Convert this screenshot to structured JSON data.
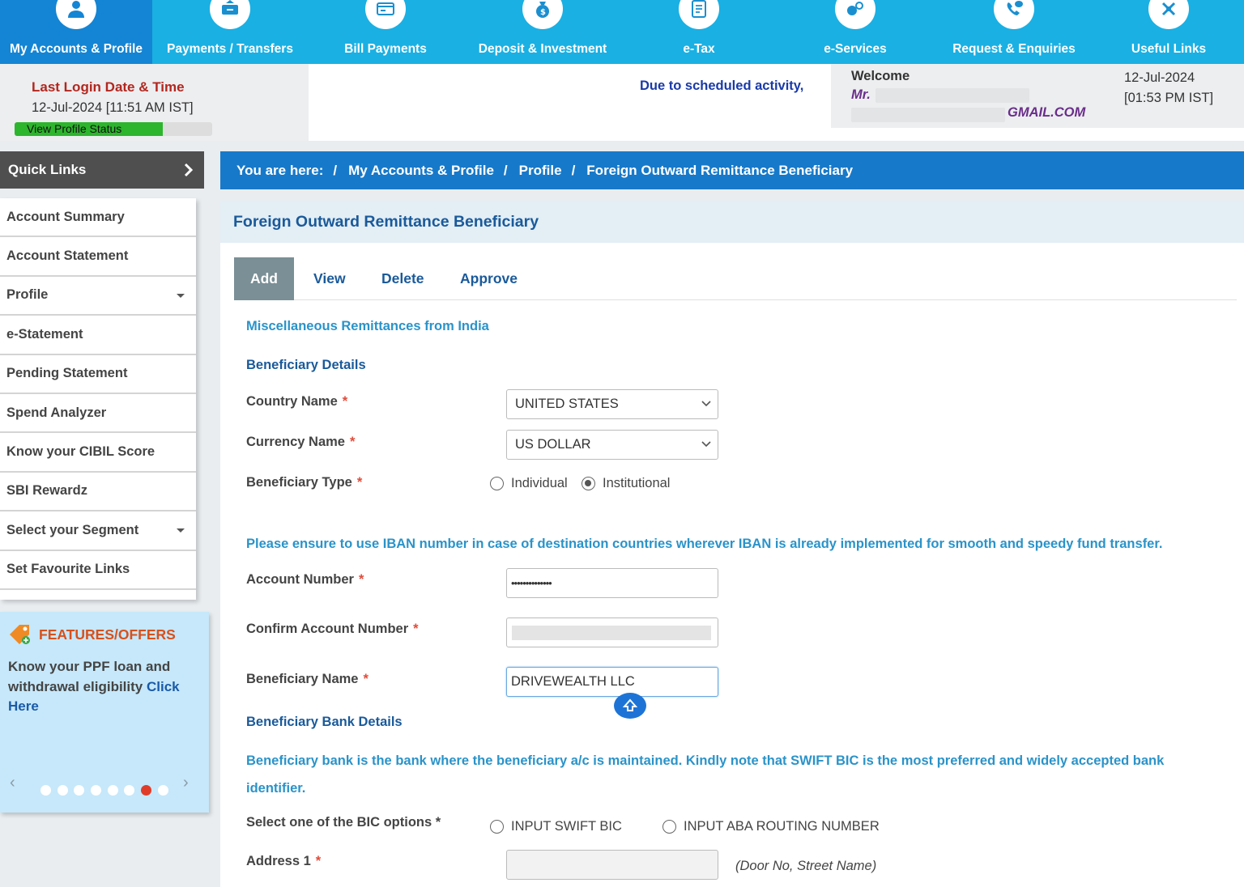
{
  "nav": [
    {
      "label": "My Accounts & Profile",
      "icon": "user-icon"
    },
    {
      "label": "Payments / Transfers",
      "icon": "transfer-icon"
    },
    {
      "label": "Bill Payments",
      "icon": "bill-icon"
    },
    {
      "label": "Deposit & Investment",
      "icon": "money-bag-icon"
    },
    {
      "label": "e-Tax",
      "icon": "tax-document-icon"
    },
    {
      "label": "e-Services",
      "icon": "services-icon"
    },
    {
      "label": "Request & Enquiries",
      "icon": "phone-chat-icon"
    },
    {
      "label": "Useful Links",
      "icon": "link-icon"
    }
  ],
  "header": {
    "last_login_title": "Last Login Date & Time",
    "last_login_value": "12-Jul-2024 [11:51 AM IST]",
    "profile_status_label": "View Profile Status",
    "profile_status_progress": 0.75,
    "marquee": "Due to scheduled activity,",
    "welcome_title": "Welcome",
    "welcome_name": "Mr.",
    "welcome_email": "GMAIL.COM",
    "date": "12-Jul-2024",
    "time": "[01:53 PM IST]"
  },
  "sidebar": {
    "quick_links_title": "Quick Links",
    "items": [
      {
        "label": "Account Summary"
      },
      {
        "label": "Account Statement"
      },
      {
        "label": "Profile"
      },
      {
        "label": "e-Statement"
      },
      {
        "label": "Pending Statement"
      },
      {
        "label": "Spend Analyzer"
      },
      {
        "label": "Know your CIBIL Score"
      },
      {
        "label": "SBI Rewardz"
      },
      {
        "label": "Select your Segment"
      },
      {
        "label": "Set Favourite Links"
      }
    ],
    "offers": {
      "title": "FEATURES/OFFERS",
      "text": "Know your PPF loan and withdrawal eligibility",
      "link": "Click Here",
      "active_slide": 7,
      "slide_count": 8
    }
  },
  "breadcrumb": {
    "prefix": "You are here:",
    "items": [
      "My Accounts & Profile",
      "Profile",
      "Foreign Outward Remittance Beneficiary"
    ]
  },
  "main": {
    "title": "Foreign Outward Remittance Beneficiary",
    "tabs": [
      "Add",
      "View",
      "Delete",
      "Approve"
    ],
    "section_misc": "Miscellaneous Remittances from India",
    "section_beneficiary": "Beneficiary Details",
    "country_label": "Country Name",
    "country_value": "UNITED STATES",
    "currency_label": "Currency Name",
    "currency_value": "US DOLLAR",
    "beneficiary_type_label": "Beneficiary Type",
    "type_individual": "Individual",
    "type_institutional": "Institutional",
    "iban_note": "Please ensure to use IBAN number in case of destination countries wherever IBAN is already implemented for smooth and speedy fund transfer.",
    "account_label": "Account Number",
    "account_value": "••••••••••••••",
    "confirm_account_label": "Confirm Account Number",
    "beneficiary_name_label": "Beneficiary Name",
    "beneficiary_name_value": "DRIVEWEALTH LLC",
    "section_bank": "Beneficiary Bank Details",
    "bank_note": "Beneficiary bank is the bank where the beneficiary a/c is maintained. Kindly note that SWIFT BIC is the most preferred and widely accepted bank identifier.",
    "bic_label": "Select one of the BIC options *",
    "bic_swift": "INPUT SWIFT BIC",
    "bic_aba": "INPUT ABA ROUTING NUMBER",
    "address1_label": "Address 1",
    "address1_hint": "(Door No, Street Name)",
    "required_mark": "*"
  }
}
